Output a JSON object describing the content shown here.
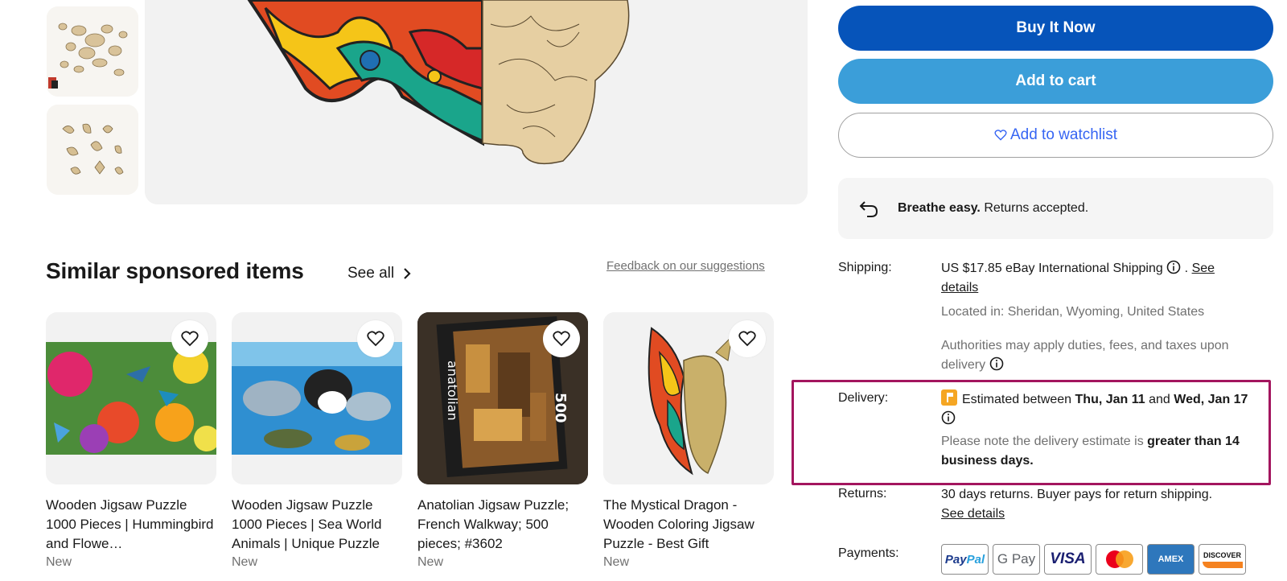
{
  "gallery": {
    "thumb_labels": [
      "puzzle-pieces-thumbnail-1",
      "puzzle-pieces-thumbnail-2"
    ]
  },
  "similar": {
    "title": "Similar sponsored items",
    "see_all": "See all",
    "feedback": "Feedback on our suggestions",
    "items": [
      {
        "title": "Wooden Jigsaw Puzzle 1000 Pieces | Hummingbird and Flowe…",
        "condition": "New"
      },
      {
        "title": "Wooden Jigsaw Puzzle 1000 Pieces | Sea World Animals | Unique Puzzle",
        "condition": "New"
      },
      {
        "title": "Anatolian Jigsaw Puzzle; French Walkway; 500 pieces; #3602",
        "condition": "New"
      },
      {
        "title": "The Mystical Dragon - Wooden Coloring Jigsaw Puzzle - Best Gift",
        "condition": "New"
      }
    ]
  },
  "actions": {
    "buy_now": "Buy It Now",
    "add_to_cart": "Add to cart",
    "watchlist": "Add to watchlist"
  },
  "returns_banner": {
    "bold": "Breathe easy.",
    "text": " Returns accepted."
  },
  "shipping": {
    "label": "Shipping:",
    "text": "US $17.85 eBay International Shipping",
    "see_details": "See",
    "details": "details",
    "location": "Located in: Sheridan, Wyoming, United States",
    "duties": "Authorities may apply duties, fees, and taxes upon delivery"
  },
  "delivery": {
    "label": "Delivery:",
    "prefix": "Estimated between ",
    "date1": "Thu, Jan 11",
    "and": " and ",
    "date2": "Wed, Jan 17",
    "note": "Please note the delivery estimate is ",
    "note_bold": "greater than 14 business days."
  },
  "returns": {
    "label": "Returns:",
    "text": "30 days returns. Buyer pays for return shipping.",
    "link": "See details"
  },
  "payments": {
    "label": "Payments:",
    "methods": [
      "PayPal",
      "G Pay",
      "VISA",
      "Mastercard",
      "AMEX",
      "DISCOVER"
    ]
  },
  "colors": {
    "buy_now": "#0654ba",
    "add_to_cart": "#3b9ed9",
    "link_blue": "#3665f3",
    "highlight": "#a3155e"
  }
}
